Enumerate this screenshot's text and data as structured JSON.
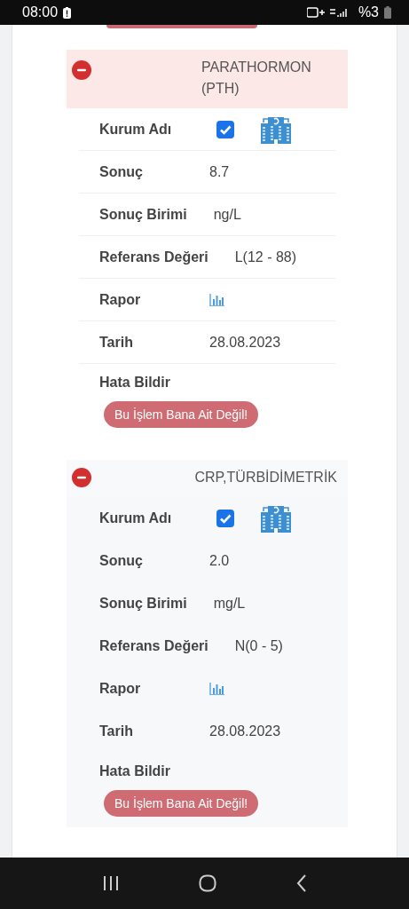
{
  "status_bar": {
    "time": "08:00",
    "battery": "%3"
  },
  "tests": [
    {
      "title": "PARATHORMON (PTH)",
      "expanded": true,
      "highlighted": true,
      "fields": [
        {
          "kind": "checkbox",
          "label": "Kurum Adı",
          "checked": true
        },
        {
          "kind": "text",
          "label": "Sonuç",
          "value": "8.7"
        },
        {
          "kind": "text",
          "label": "Sonuç Birimi",
          "value": "ng/L"
        },
        {
          "kind": "text",
          "label": "Referans Değeri",
          "value": "L(12 - 88)"
        },
        {
          "kind": "chart",
          "label": "Rapor"
        },
        {
          "kind": "text",
          "label": "Tarih",
          "value": "28.08.2023"
        }
      ],
      "report_label": "Hata Bildir",
      "report_button": "Bu İşlem Bana Ait Değil!"
    },
    {
      "title": "CRP,TÜRBİDİMETRİK",
      "expanded": true,
      "highlighted": false,
      "fields": [
        {
          "kind": "checkbox",
          "label": "Kurum Adı",
          "checked": true
        },
        {
          "kind": "text",
          "label": "Sonuç",
          "value": "2.0"
        },
        {
          "kind": "text",
          "label": "Sonuç Birimi",
          "value": "mg/L"
        },
        {
          "kind": "text",
          "label": "Referans Değeri",
          "value": "N(0 - 5)"
        },
        {
          "kind": "chart",
          "label": "Rapor"
        },
        {
          "kind": "text",
          "label": "Tarih",
          "value": "28.08.2023"
        }
      ],
      "report_label": "Hata Bildir",
      "report_button": "Bu İşlem Bana Ait Değil!"
    }
  ]
}
